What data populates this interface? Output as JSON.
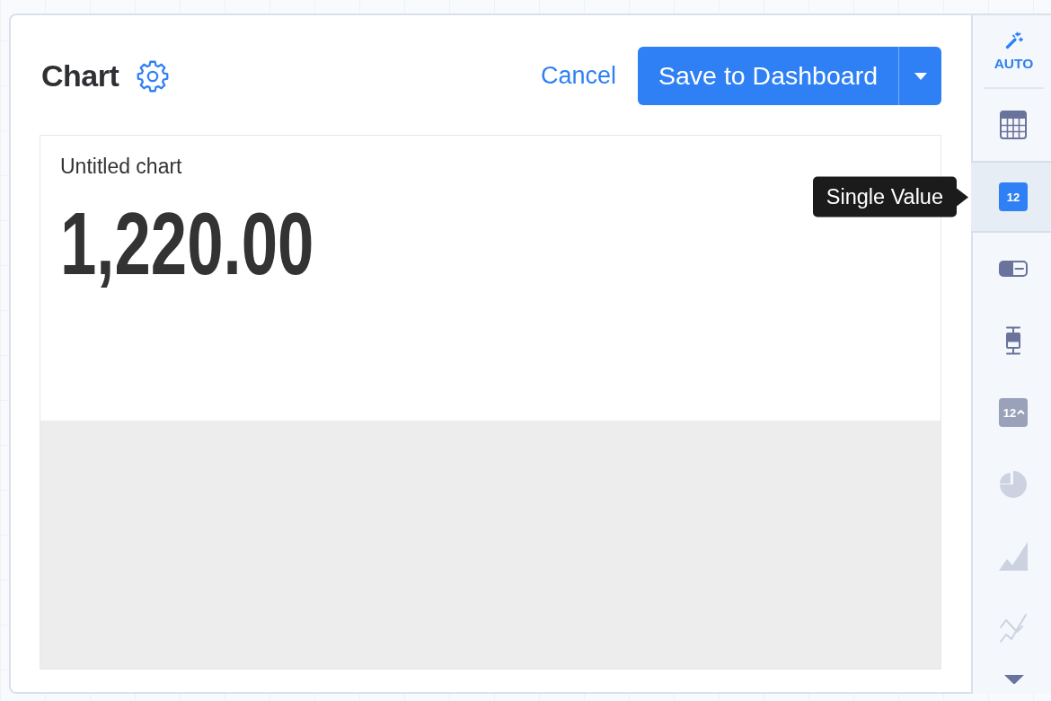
{
  "header": {
    "title": "Chart",
    "cancel_link": "Cancel",
    "save_button": "Save to Dashboard"
  },
  "chart_card": {
    "title": "Untitled chart",
    "value": "1,220.00"
  },
  "sidebar": {
    "auto_button": {
      "label": "AUTO"
    },
    "items": [
      {
        "kind": "table",
        "selected": false,
        "disabled": false
      },
      {
        "kind": "number",
        "icon_text": "12",
        "selected": true,
        "disabled": false
      },
      {
        "kind": "progress",
        "selected": false,
        "disabled": false
      },
      {
        "kind": "box_plot",
        "selected": false,
        "disabled": false
      },
      {
        "kind": "trend",
        "icon_text": "12",
        "selected": false,
        "disabled": true
      },
      {
        "kind": "pie",
        "selected": false,
        "disabled": true
      },
      {
        "kind": "area",
        "selected": false,
        "disabled": true
      },
      {
        "kind": "line",
        "selected": false,
        "disabled": true
      }
    ]
  },
  "tooltip": {
    "text": "Single Value"
  }
}
